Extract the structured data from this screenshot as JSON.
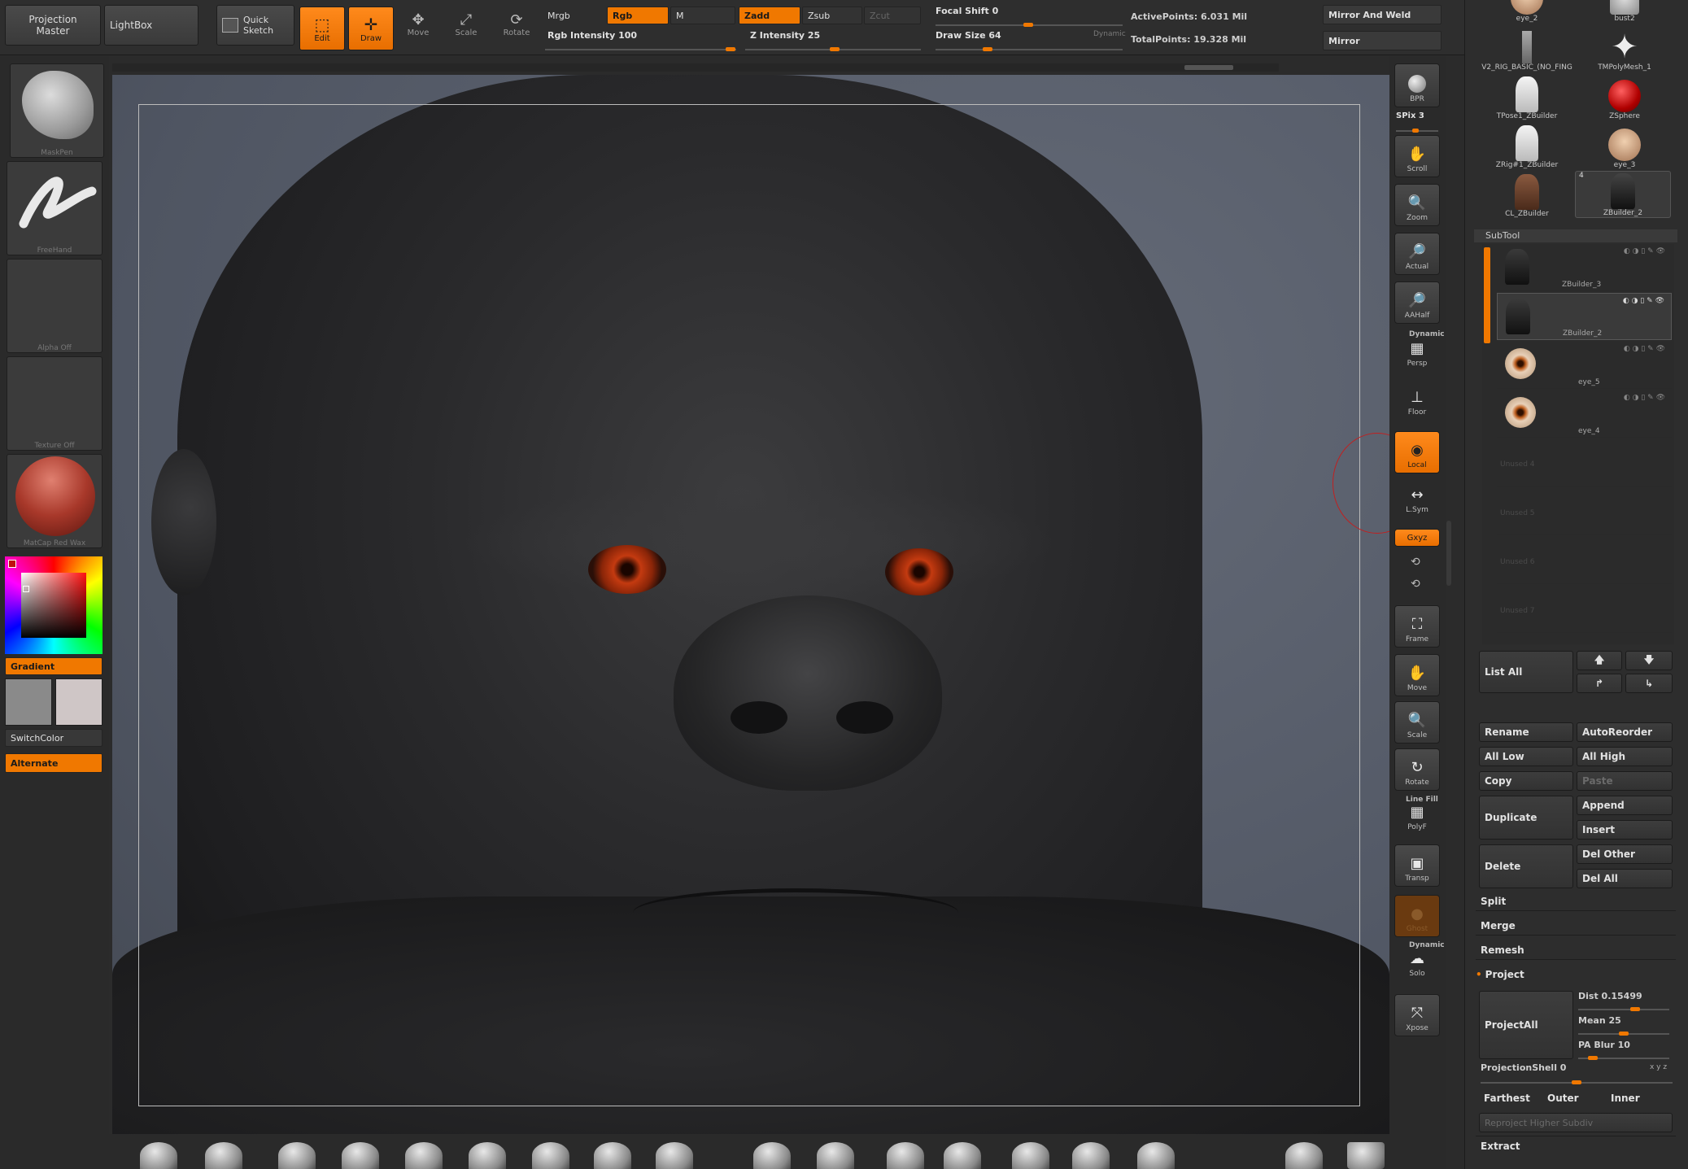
{
  "top": {
    "projection_master": "Projection Master",
    "lightbox": "LightBox",
    "quick_sketch": "Quick Sketch",
    "edit": "Edit",
    "draw": "Draw",
    "move": "Move",
    "scale": "Scale",
    "rotate": "Rotate",
    "mrgb": "Mrgb",
    "rgb": "Rgb",
    "m": "M",
    "zadd": "Zadd",
    "zsub": "Zsub",
    "zcut": "Zcut",
    "rgb_intensity": "Rgb Intensity 100",
    "z_intensity": "Z Intensity 25",
    "focal_shift": "Focal Shift 0",
    "draw_size": "Draw Size 64",
    "dynamic": "Dynamic",
    "active_points": "ActivePoints: 6.031 Mil",
    "total_points": "TotalPoints: 19.328 Mil",
    "mirror_and_weld": "Mirror And Weld",
    "mirror": "Mirror"
  },
  "left": {
    "brush": "MaskPen",
    "stroke": "FreeHand",
    "alpha": "Alpha Off",
    "texture": "Texture Off",
    "material": "MatCap Red Wax",
    "gradient": "Gradient",
    "switch_color": "SwitchColor",
    "alternate": "Alternate"
  },
  "right_shelf": {
    "bpr": "BPR",
    "spix": "SPix 3",
    "scroll": "Scroll",
    "zoom": "Zoom",
    "actual": "Actual",
    "aahalf": "AAHalf",
    "dynamic": "Dynamic",
    "persp": "Persp",
    "floor": "Floor",
    "local": "Local",
    "lsym": "L.Sym",
    "xyz": "Gxyz",
    "frame": "Frame",
    "move": "Move",
    "scale": "Scale",
    "rotate": "Rotate",
    "line_fill": "Line Fill",
    "polyf": "PolyF",
    "transp": "Transp",
    "ghost": "Ghost",
    "dynamic2": "Dynamic",
    "solo": "Solo",
    "xpose": "Xpose"
  },
  "tools": [
    {
      "label": "eye_2"
    },
    {
      "label": "bust2"
    },
    {
      "label": "V2_RIG_BASIC_(NO_FING"
    },
    {
      "label": "TMPolyMesh_1"
    },
    {
      "label": "TPose1_ZBuilder"
    },
    {
      "label": "ZSphere"
    },
    {
      "label": "ZRig#1_ZBuilder"
    },
    {
      "label": "eye_3"
    },
    {
      "label": "CL_ZBuilder"
    },
    {
      "label": "ZBuilder_2"
    }
  ],
  "tool_badge": "4",
  "subtool": {
    "title": "SubTool",
    "items": [
      {
        "label": "ZBuilder_3"
      },
      {
        "label": "ZBuilder_2"
      },
      {
        "label": "eye_5"
      },
      {
        "label": "eye_4"
      },
      {
        "label": "Unused 4"
      },
      {
        "label": "Unused 5"
      },
      {
        "label": "Unused 6"
      },
      {
        "label": "Unused 7"
      }
    ],
    "list_all": "List All",
    "rename": "Rename",
    "auto_reorder": "AutoReorder",
    "all_low": "All Low",
    "all_high": "All High",
    "copy": "Copy",
    "paste": "Paste",
    "duplicate": "Duplicate",
    "append": "Append",
    "insert": "Insert",
    "delete": "Delete",
    "del_other": "Del Other",
    "del_all": "Del All",
    "split": "Split",
    "merge": "Merge",
    "remesh": "Remesh",
    "project": "Project",
    "project_all": "ProjectAll",
    "dist": "Dist 0.15499",
    "mean": "Mean 25",
    "pa_blur": "PA Blur 10",
    "projection_shell": "ProjectionShell 0",
    "farthest": "Farthest",
    "outer": "Outer",
    "inner": "Inner",
    "reproject": "Reproject Higher Subdiv",
    "extract": "Extract"
  },
  "colors": {
    "accent": "#f07800",
    "canvas_bg": "#59606e",
    "panel": "#2b2b2b"
  }
}
